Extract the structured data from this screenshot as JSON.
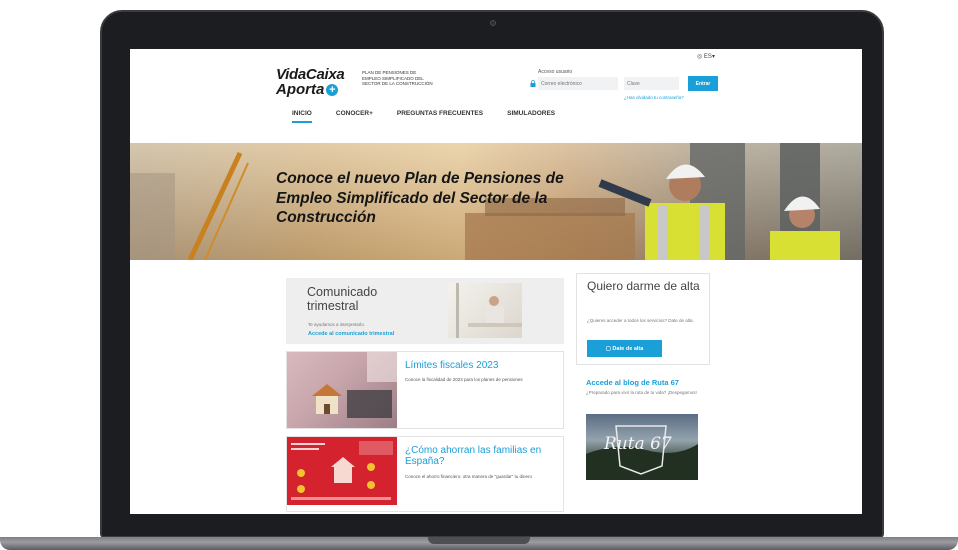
{
  "header": {
    "language": "ES",
    "logo_line1": "VidaCaixa",
    "logo_line2": "Aporta",
    "plan_description": "PLAN DE PENSIONES DE EMPLEO SIMPLIFICADO DEL SECTOR DE LA CONSTRUCCIÓN",
    "login": {
      "label": "Acceso usuario",
      "email_placeholder": "Correo electrónico",
      "password_placeholder": "Clave",
      "button_label": "Entrar",
      "forgot_link": "¿Has olvidado tu contraseña?"
    }
  },
  "nav": {
    "items": [
      {
        "label": "INICIO"
      },
      {
        "label": "CONOCER+"
      },
      {
        "label": "PREGUNTAS FRECUENTES"
      },
      {
        "label": "SIMULADORES"
      }
    ]
  },
  "hero": {
    "title": "Conoce el nuevo Plan de Pensiones de Empleo Simplificado del Sector de la Construcción"
  },
  "comunicado": {
    "title": "Comunicado trimestral",
    "text": "Te ayudamos a interpretarlo.",
    "link": "Accede al comunicado trimestral"
  },
  "limites": {
    "title": "Límites fiscales 2023",
    "text": "Conoce la fiscalidad de 2023 para los planes de pensiones"
  },
  "ahorro": {
    "title": "¿Cómo ahorran las familias en España?",
    "text": "Conoce el ahorro financiero: otra manera de \"guardar\" tu dinero"
  },
  "alta": {
    "title": "Quiero darme de alta",
    "text": "¿Quieres acceder a todos los servicios? Date de alta.",
    "button_label": "Date de alta"
  },
  "blog": {
    "title": "Accede al blog de Ruta 67",
    "text": "¿Preparado para vivir la ruta de tu vida? ¡Despegamos!",
    "image_text": "Ruta 67"
  },
  "colors": {
    "accent": "#1a9fd8",
    "laptop_frame": "#1c1d20"
  }
}
